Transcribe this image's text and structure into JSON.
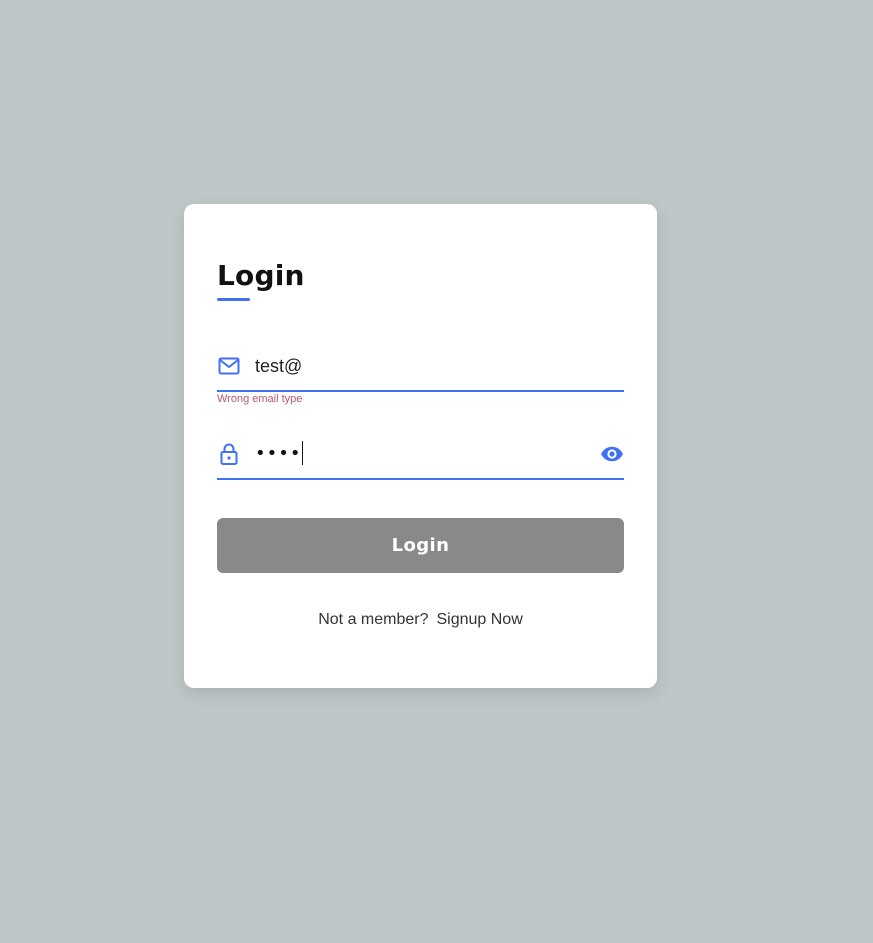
{
  "login_card": {
    "title": "Login",
    "email": {
      "value": "test@",
      "error": "Wrong email type",
      "icon": "mail-icon"
    },
    "password": {
      "masked_value": "••••",
      "icon": "lock-icon",
      "toggle_icon": "eye-icon"
    },
    "login_button_label": "Login",
    "signup_prompt": "Not a member?",
    "signup_link_label": "Signup Now"
  },
  "colors": {
    "page_background": "#bec6c7",
    "accent": "#4070f4",
    "button_background": "#898987",
    "error_text": "#b05a6e",
    "card_background": "#ffffff"
  }
}
